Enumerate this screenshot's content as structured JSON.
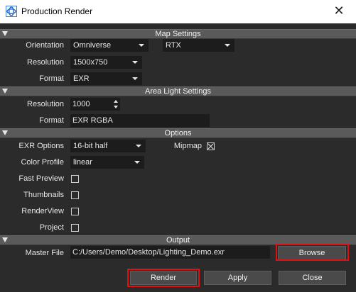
{
  "window": {
    "title": "Production Render",
    "app_icon": "omniverse-icon",
    "close_icon": "close-icon"
  },
  "sections": {
    "map_settings": "Map Settings",
    "area_light_settings": "Area Light Settings",
    "options": "Options",
    "output": "Output"
  },
  "map_settings": {
    "orientation_label": "Orientation",
    "orientation_value": "Omniverse",
    "renderer_value": "RTX",
    "resolution_label": "Resolution",
    "resolution_value": "1500x750",
    "format_label": "Format",
    "format_value": "EXR"
  },
  "area_light_settings": {
    "resolution_label": "Resolution",
    "resolution_value": "1000",
    "format_label": "Format",
    "format_value": "EXR RGBA"
  },
  "options": {
    "exr_options_label": "EXR Options",
    "exr_options_value": "16-bit half",
    "mipmap_label": "Mipmap",
    "mipmap_checked": true,
    "color_profile_label": "Color Profile",
    "color_profile_value": "linear",
    "fast_preview_label": "Fast Preview",
    "fast_preview_checked": false,
    "thumbnails_label": "Thumbnails",
    "thumbnails_checked": false,
    "renderview_label": "RenderView",
    "renderview_checked": false,
    "project_label": "Project",
    "project_checked": false
  },
  "output": {
    "master_file_label": "Master File",
    "master_file_value": "C:/Users/Demo/Desktop/Lighting_Demo.exr",
    "browse_label": "Browse"
  },
  "footer": {
    "render_label": "Render",
    "apply_label": "Apply",
    "close_label": "Close"
  },
  "colors": {
    "highlight": "#e01010",
    "background": "#2b2b2b",
    "section_bar": "#5a5a5a"
  }
}
